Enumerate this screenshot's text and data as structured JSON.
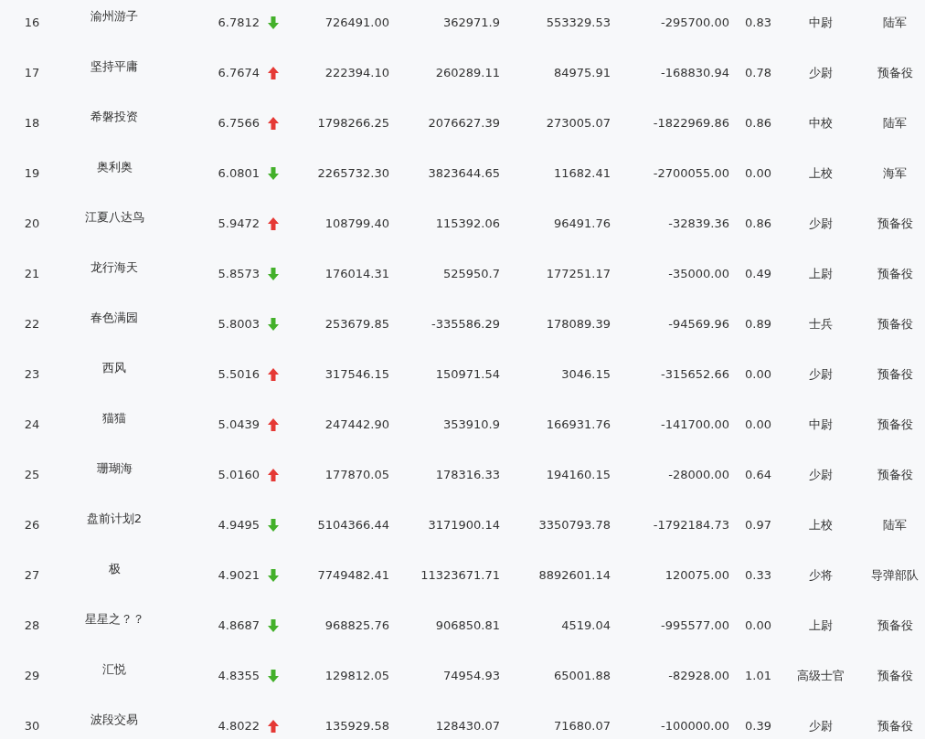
{
  "table": {
    "rows": [
      {
        "rank": "16",
        "name": "渝州游子",
        "value": "6.7812",
        "rising": false,
        "column_4": "726491.00",
        "column_5": "362971.9",
        "column_6": "553329.53",
        "column_7": "-295700.00",
        "column_8": "0.83",
        "column_9": "中尉",
        "column_10": "陆军"
      },
      {
        "rank": "17",
        "name": "坚持平庸",
        "value": "6.7674",
        "rising": true,
        "column_4": "222394.10",
        "column_5": "260289.11",
        "column_6": "84975.91",
        "column_7": "-168830.94",
        "column_8": "0.78",
        "column_9": "少尉",
        "column_10": "预备役"
      },
      {
        "rank": "18",
        "name": "希磐投资",
        "value": "6.7566",
        "rising": true,
        "column_4": "1798266.25",
        "column_5": "2076627.39",
        "column_6": "273005.07",
        "column_7": "-1822969.86",
        "column_8": "0.86",
        "column_9": "中校",
        "column_10": "陆军"
      },
      {
        "rank": "19",
        "name": "奥利奥",
        "value": "6.0801",
        "rising": false,
        "column_4": "2265732.30",
        "column_5": "3823644.65",
        "column_6": "11682.41",
        "column_7": "-2700055.00",
        "column_8": "0.00",
        "column_9": "上校",
        "column_10": "海军"
      },
      {
        "rank": "20",
        "name": "江夏八达鸟",
        "value": "5.9472",
        "rising": true,
        "column_4": "108799.40",
        "column_5": "115392.06",
        "column_6": "96491.76",
        "column_7": "-32839.36",
        "column_8": "0.86",
        "column_9": "少尉",
        "column_10": "预备役"
      },
      {
        "rank": "21",
        "name": "龙行海天",
        "value": "5.8573",
        "rising": false,
        "column_4": "176014.31",
        "column_5": "525950.7",
        "column_6": "177251.17",
        "column_7": "-35000.00",
        "column_8": "0.49",
        "column_9": "上尉",
        "column_10": "预备役"
      },
      {
        "rank": "22",
        "name": "春色满园",
        "value": "5.8003",
        "rising": false,
        "column_4": "253679.85",
        "column_5": "-335586.29",
        "column_6": "178089.39",
        "column_7": "-94569.96",
        "column_8": "0.89",
        "column_9": "士兵",
        "column_10": "预备役"
      },
      {
        "rank": "23",
        "name": "西风",
        "value": "5.5016",
        "rising": true,
        "column_4": "317546.15",
        "column_5": "150971.54",
        "column_6": "3046.15",
        "column_7": "-315652.66",
        "column_8": "0.00",
        "column_9": "少尉",
        "column_10": "预备役"
      },
      {
        "rank": "24",
        "name": "猫猫",
        "value": "5.0439",
        "rising": true,
        "column_4": "247442.90",
        "column_5": "353910.9",
        "column_6": "166931.76",
        "column_7": "-141700.00",
        "column_8": "0.00",
        "column_9": "中尉",
        "column_10": "预备役"
      },
      {
        "rank": "25",
        "name": "珊瑚海",
        "value": "5.0160",
        "rising": true,
        "column_4": "177870.05",
        "column_5": "178316.33",
        "column_6": "194160.15",
        "column_7": "-28000.00",
        "column_8": "0.64",
        "column_9": "少尉",
        "column_10": "预备役"
      },
      {
        "rank": "26",
        "name": "盘前计划2",
        "value": "4.9495",
        "rising": false,
        "column_4": "5104366.44",
        "column_5": "3171900.14",
        "column_6": "3350793.78",
        "column_7": "-1792184.73",
        "column_8": "0.97",
        "column_9": "上校",
        "column_10": "陆军"
      },
      {
        "rank": "27",
        "name": "极",
        "value": "4.9021",
        "rising": false,
        "column_4": "7749482.41",
        "column_5": "11323671.71",
        "column_6": "8892601.14",
        "column_7": "120075.00",
        "column_8": "0.33",
        "column_9": "少将",
        "column_10": "导弹部队"
      },
      {
        "rank": "28",
        "name": "星星之？？",
        "value": "4.8687",
        "rising": false,
        "column_4": "968825.76",
        "column_5": "906850.81",
        "column_6": "4519.04",
        "column_7": "-995577.00",
        "column_8": "0.00",
        "column_9": "上尉",
        "column_10": "预备役"
      },
      {
        "rank": "29",
        "name": "汇悦",
        "value": "4.8355",
        "rising": false,
        "column_4": "129812.05",
        "column_5": "74954.93",
        "column_6": "65001.88",
        "column_7": "-82928.00",
        "column_8": "1.01",
        "column_9": "高级士官",
        "column_10": "预备役"
      },
      {
        "rank": "30",
        "name": "波段交易",
        "value": "4.8022",
        "rising": true,
        "column_4": "135929.58",
        "column_5": "128430.07",
        "column_6": "71680.07",
        "column_7": "-100000.00",
        "column_8": "0.39",
        "column_9": "少尉",
        "column_10": "预备役"
      }
    ]
  }
}
